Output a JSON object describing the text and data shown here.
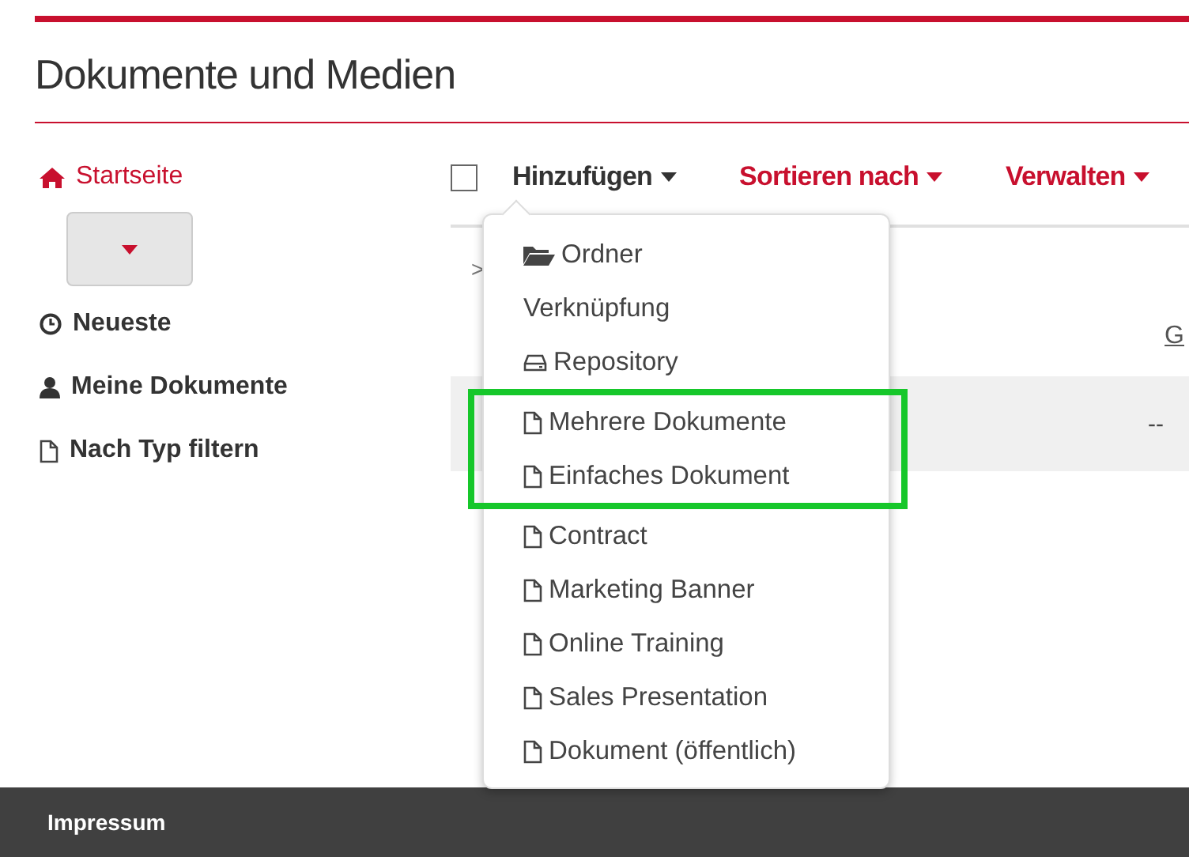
{
  "page_title": "Dokumente und Medien",
  "sidebar": {
    "items": [
      {
        "label": "Startseite",
        "kind": "home",
        "selected": true
      },
      {
        "kind": "dropdown",
        "selected": false
      },
      {
        "label": "Neueste",
        "kind": "recent",
        "selected": false
      },
      {
        "label": "Meine Dokumente",
        "kind": "user",
        "selected": false
      },
      {
        "label": "Nach Typ filtern",
        "kind": "document",
        "selected": false
      }
    ]
  },
  "toolbar": {
    "select_all_checked": false,
    "menus": [
      {
        "label": "Hinzufügen",
        "expanded": true
      },
      {
        "label": "Sortieren nach",
        "expanded": false
      },
      {
        "label": "Verwalten",
        "expanded": false
      }
    ]
  },
  "add_menu": {
    "items": [
      {
        "label": "Ordner",
        "kind": "folder",
        "highlighted": false
      },
      {
        "label": "Verknüpfung",
        "kind": "plain",
        "highlighted": false
      },
      {
        "label": "Repository",
        "kind": "repository",
        "highlighted": false
      },
      {
        "label": "Mehrere Dokumente",
        "kind": "document",
        "highlighted": true
      },
      {
        "label": "Einfaches Dokument",
        "kind": "document",
        "highlighted": true
      },
      {
        "label": "Contract",
        "kind": "document",
        "highlighted": false
      },
      {
        "label": "Marketing Banner",
        "kind": "document",
        "highlighted": false
      },
      {
        "label": "Online Training",
        "kind": "document",
        "highlighted": false
      },
      {
        "label": "Sales Presentation",
        "kind": "document",
        "highlighted": false
      },
      {
        "label": "Dokument (öffentlich)",
        "kind": "document",
        "highlighted": false
      }
    ]
  },
  "content": {
    "breadcrumb_marker": ">",
    "column_header": "G",
    "row_value": "--"
  },
  "footer": {
    "link": "Impressum"
  }
}
